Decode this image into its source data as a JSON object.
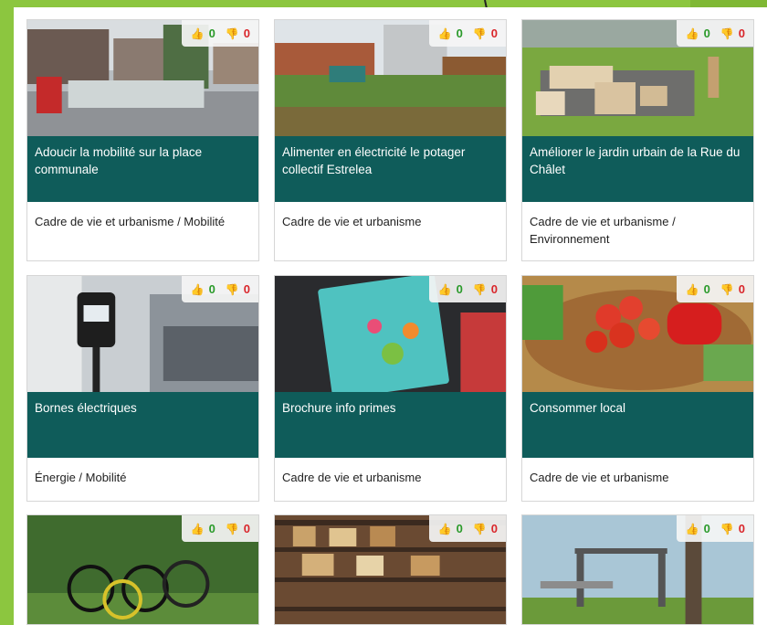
{
  "projects": [
    {
      "title": "Adoucir la mobilité sur la place communale",
      "category": "Cadre de vie et urbanisme / Mobilité",
      "up": "0",
      "down": "0",
      "thumb_up_icon": "thumbs-up-icon",
      "thumb_down_icon": "thumbs-down-icon"
    },
    {
      "title": "Alimenter en électricité le potager collectif Estrelea",
      "category": "Cadre de vie et urbanisme",
      "up": "0",
      "down": "0"
    },
    {
      "title": "Améliorer le jardin urbain de la Rue du Châlet",
      "category": "Cadre de vie et urbanisme / Environnement",
      "up": "0",
      "down": "0"
    },
    {
      "title": "Bornes électriques",
      "category": "Énergie / Mobilité",
      "up": "0",
      "down": "0"
    },
    {
      "title": "Brochure info primes",
      "category": "Cadre de vie et urbanisme",
      "up": "0",
      "down": "0"
    },
    {
      "title": "Consommer local",
      "category": "Cadre de vie et urbanisme",
      "up": "0",
      "down": "0"
    },
    {
      "title": "",
      "category": "",
      "up": "0",
      "down": "0"
    },
    {
      "title": "",
      "category": "",
      "up": "0",
      "down": "0"
    },
    {
      "title": "",
      "category": "",
      "up": "0",
      "down": "0"
    }
  ],
  "colors": {
    "title_bg": "#0f5c5a",
    "up": "#2a9a2a",
    "down": "#d9262b",
    "page_bg": "#8cc63f"
  }
}
